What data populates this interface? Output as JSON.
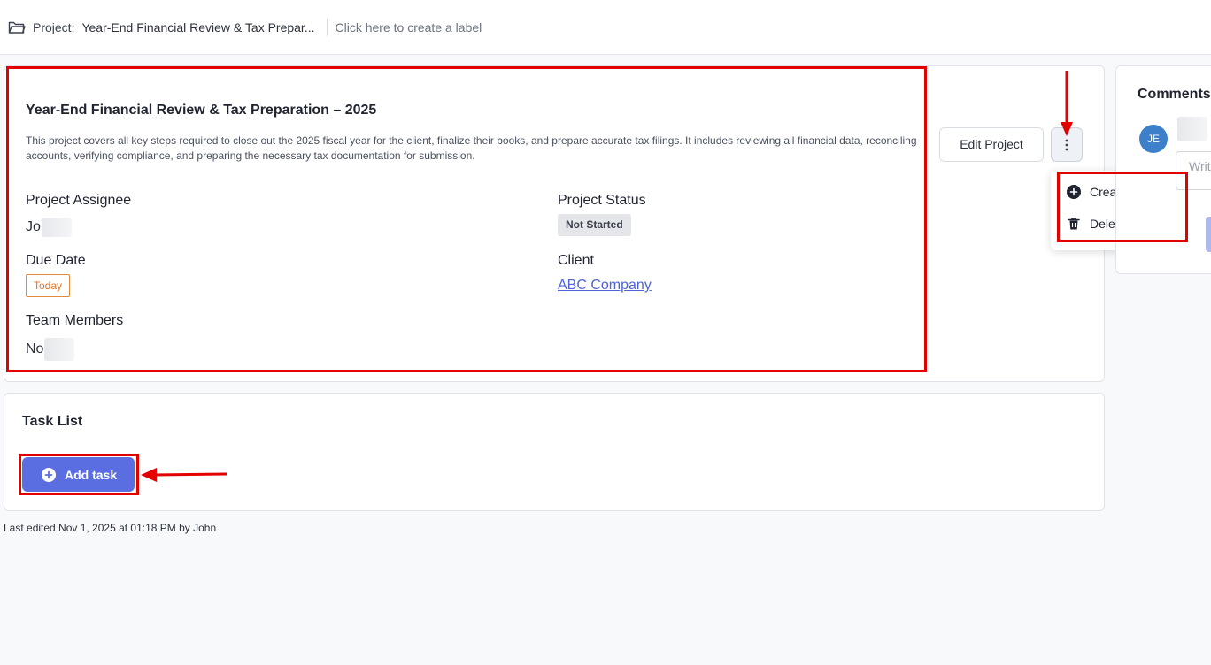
{
  "topbar": {
    "project_prefix": "Project:",
    "project_title": "Year-End Financial Review & Tax Prepar...",
    "label_link": "Click here to create a label"
  },
  "project": {
    "title": "Year-End Financial Review & Tax Preparation – 2025",
    "description": "This project covers all key steps required to close out the 2025 fiscal year for the client, finalize their books, and prepare accurate tax filings. It includes reviewing all financial data, reconciling accounts, verifying compliance, and preparing the necessary tax documentation for submission.",
    "assignee_label": "Project Assignee",
    "assignee_value": "Jo",
    "status_label": "Project Status",
    "status_value": "Not Started",
    "due_label": "Due Date",
    "due_value": "Today",
    "client_label": "Client",
    "client_value": "ABC Company",
    "team_label": "Team Members",
    "team_value": "No"
  },
  "actions": {
    "edit_label": "Edit Project",
    "more_icon": "more-vertical-icon"
  },
  "menu": {
    "items": [
      {
        "label": "Create a Series",
        "icon": "plus-circle-icon"
      },
      {
        "label": "Delete",
        "icon": "trash-icon"
      }
    ]
  },
  "tasks": {
    "title": "Task List",
    "add_label": "Add task"
  },
  "footer": {
    "last_edited": "Last edited Nov 1, 2025 at 01:18 PM by John"
  },
  "comments": {
    "title": "Comments",
    "avatar_initials": "JE",
    "input_placeholder": "Write"
  },
  "colors": {
    "accent": "#5b6ee1",
    "highlight": "#e50000",
    "due_badge": "#d9772a",
    "link": "#4f63d9"
  }
}
